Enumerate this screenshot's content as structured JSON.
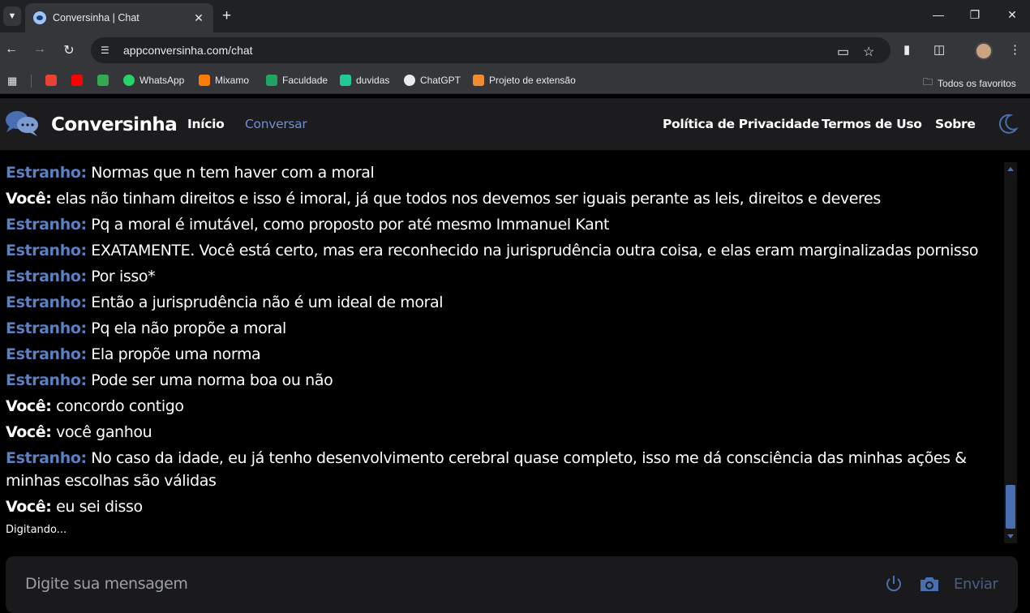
{
  "browser": {
    "tab_title": "Conversinha | Chat",
    "url": "appconversinha.com/chat",
    "bookmarks": [
      {
        "label": "",
        "icon": "gmail-icon",
        "color": "#ea4335"
      },
      {
        "label": "",
        "icon": "youtube-icon",
        "color": "#ff0000"
      },
      {
        "label": "",
        "icon": "maps-icon",
        "color": "#34a853"
      },
      {
        "label": "WhatsApp",
        "icon": "whatsapp-icon",
        "color": "#25d366"
      },
      {
        "label": "Mixamo",
        "icon": "mixamo-icon",
        "color": "#ff7a00"
      },
      {
        "label": "Faculdade",
        "icon": "faculdade-icon",
        "color": "#1fa463"
      },
      {
        "label": "duvidas",
        "icon": "duvidas-icon",
        "color": "#20c997"
      },
      {
        "label": "ChatGPT",
        "icon": "chatgpt-icon",
        "color": "#e8eaed"
      },
      {
        "label": "Projeto de extensão",
        "icon": "projeto-icon",
        "color": "#f28b30"
      }
    ],
    "all_bookmarks": "Todos os favoritos"
  },
  "header": {
    "brand": "Conversinha",
    "nav_left": [
      "Início",
      "Conversar"
    ],
    "nav_right": [
      "Política de Privacidade",
      "Termos de Uso",
      "Sobre"
    ]
  },
  "messages": [
    {
      "sender": "Estranho:",
      "type": "stranger",
      "text": " Normas que n tem haver com a moral"
    },
    {
      "sender": "Você:",
      "type": "you",
      "text": " elas não tinham direitos e isso é imoral, já que todos nos devemos ser iguais perante as leis, direitos e deveres"
    },
    {
      "sender": "Estranho:",
      "type": "stranger",
      "text": " Pq a moral é imutável, como proposto por até mesmo Immanuel Kant"
    },
    {
      "sender": "Estranho:",
      "type": "stranger",
      "text": " EXATAMENTE. Você está certo, mas era reconhecido na jurisprudência outra coisa, e elas eram marginalizadas pornisso"
    },
    {
      "sender": "Estranho:",
      "type": "stranger",
      "text": " Por isso*"
    },
    {
      "sender": "Estranho:",
      "type": "stranger",
      "text": " Então a jurisprudência não é um ideal de moral"
    },
    {
      "sender": "Estranho:",
      "type": "stranger",
      "text": " Pq ela não propõe a moral"
    },
    {
      "sender": "Estranho:",
      "type": "stranger",
      "text": " Ela propõe uma norma"
    },
    {
      "sender": "Estranho:",
      "type": "stranger",
      "text": " Pode ser uma norma boa ou não"
    },
    {
      "sender": "Você:",
      "type": "you",
      "text": " concordo contigo"
    },
    {
      "sender": "Você:",
      "type": "you",
      "text": " você ganhou"
    },
    {
      "sender": "Estranho:",
      "type": "stranger",
      "text": " No caso da idade, eu já tenho desenvolvimento cerebral quase completo, isso me dá consciência das minhas ações & minhas escolhas são válidas"
    },
    {
      "sender": "Você:",
      "type": "you",
      "text": " eu sei disso"
    }
  ],
  "typing_status": "Digitando...",
  "input": {
    "placeholder": "Digite sua mensagem",
    "send_label": "Enviar"
  },
  "colors": {
    "accent": "#5a80c2",
    "active_nav": "#6e8fd6"
  }
}
